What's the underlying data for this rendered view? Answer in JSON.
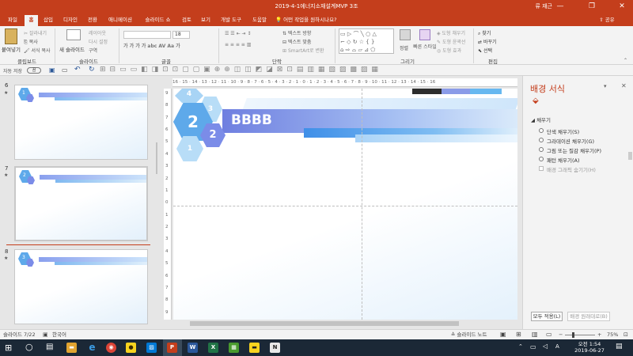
{
  "titlebar": {
    "title": "2019-4-1에너지소재설계MVP 3조",
    "user": "류 재근",
    "minimize": "—",
    "restore": "❐",
    "close": "✕"
  },
  "tabs": [
    {
      "label": "파일"
    },
    {
      "label": "홈"
    },
    {
      "label": "삽입"
    },
    {
      "label": "디자인"
    },
    {
      "label": "전환"
    },
    {
      "label": "애니메이션"
    },
    {
      "label": "슬라이드 쇼"
    },
    {
      "label": "검토"
    },
    {
      "label": "보기"
    },
    {
      "label": "개발 도구"
    },
    {
      "label": "도움말"
    },
    {
      "label": "어떤 작업을 원하시나요?"
    }
  ],
  "share_label": "공유",
  "ribbon": {
    "clipboard": {
      "label": "클립보드",
      "paste": "붙여넣기",
      "cut": "잘라내기",
      "copy": "복사",
      "format_painter": "서식 복사"
    },
    "slides": {
      "label": "슬라이드",
      "new_slide": "새 슬라이드",
      "layout": "레이아웃",
      "reset": "다시 설정",
      "section": "구역"
    },
    "font": {
      "label": "글꼴",
      "font_size": "18"
    },
    "paragraph": {
      "label": "단락",
      "text_direction": "텍스트 방향",
      "align_text": "텍스트 맞춤",
      "smartart": "SmartArt로 변환"
    },
    "drawing": {
      "label": "그리기",
      "arrange": "정렬",
      "quick_styles": "빠른 스타일",
      "shape_fill": "도형 채우기",
      "shape_outline": "도형 윤곽선",
      "shape_effects": "도형 효과"
    },
    "editing": {
      "label": "편집",
      "find": "찾기",
      "replace": "바꾸기",
      "select": "선택"
    }
  },
  "qat": {
    "autosave": "자동 저장",
    "autosave_state": "끔"
  },
  "thumbnails": [
    {
      "number": "6",
      "title": "AAAA",
      "hex_num": "1"
    },
    {
      "number": "7",
      "title": "BBBB",
      "hex_num": "2"
    },
    {
      "number": "8",
      "title": "CCCC",
      "hex_num": "3"
    }
  ],
  "ruler": {
    "h": "16 · 15 · 14 · 13 · 12 · 11 · 10 · 9 · 8 · 7 · 6 · 5 · 4 · 3 · 2 · 1 · 0 · 1 · 2 · 3 · 4 · 5 · 6 · 7 · 8 · 9 · 10 · 11 · 12 · 13 · 14 · 15 · 16",
    "v": [
      "9",
      "8",
      "7",
      "6",
      "5",
      "4",
      "3",
      "2",
      "1",
      "0",
      "1",
      "2",
      "3",
      "4",
      "5",
      "6",
      "7",
      "8",
      "9"
    ]
  },
  "slide": {
    "title": "BBBB",
    "hex_main": "2",
    "hex_small": "2",
    "hex_top": "4",
    "hex_right": "3",
    "hex_bottom": "1"
  },
  "pane": {
    "title": "배경 서식",
    "section": "채우기",
    "options": [
      "단색 채우기(S)",
      "그라데이션 채우기(G)",
      "그림 또는 질감 채우기(P)",
      "패턴 채우기(A)"
    ],
    "hide_bg": "배경 그래픽 숨기기(H)",
    "apply_all": "모두 적용(L)",
    "reset_bg": "배경 원래대로(B)"
  },
  "status": {
    "slide": "슬라이드 7/22",
    "language": "한국어",
    "notes": "슬라이드 노트",
    "zoom": "75%"
  },
  "taskbar": {
    "time": "오전 1:54",
    "date": "2019-06-27"
  },
  "colors": {
    "accent": "#c43e1c",
    "hex_blue": "#5ea9ea",
    "hex_purple": "#7b8ce8"
  }
}
